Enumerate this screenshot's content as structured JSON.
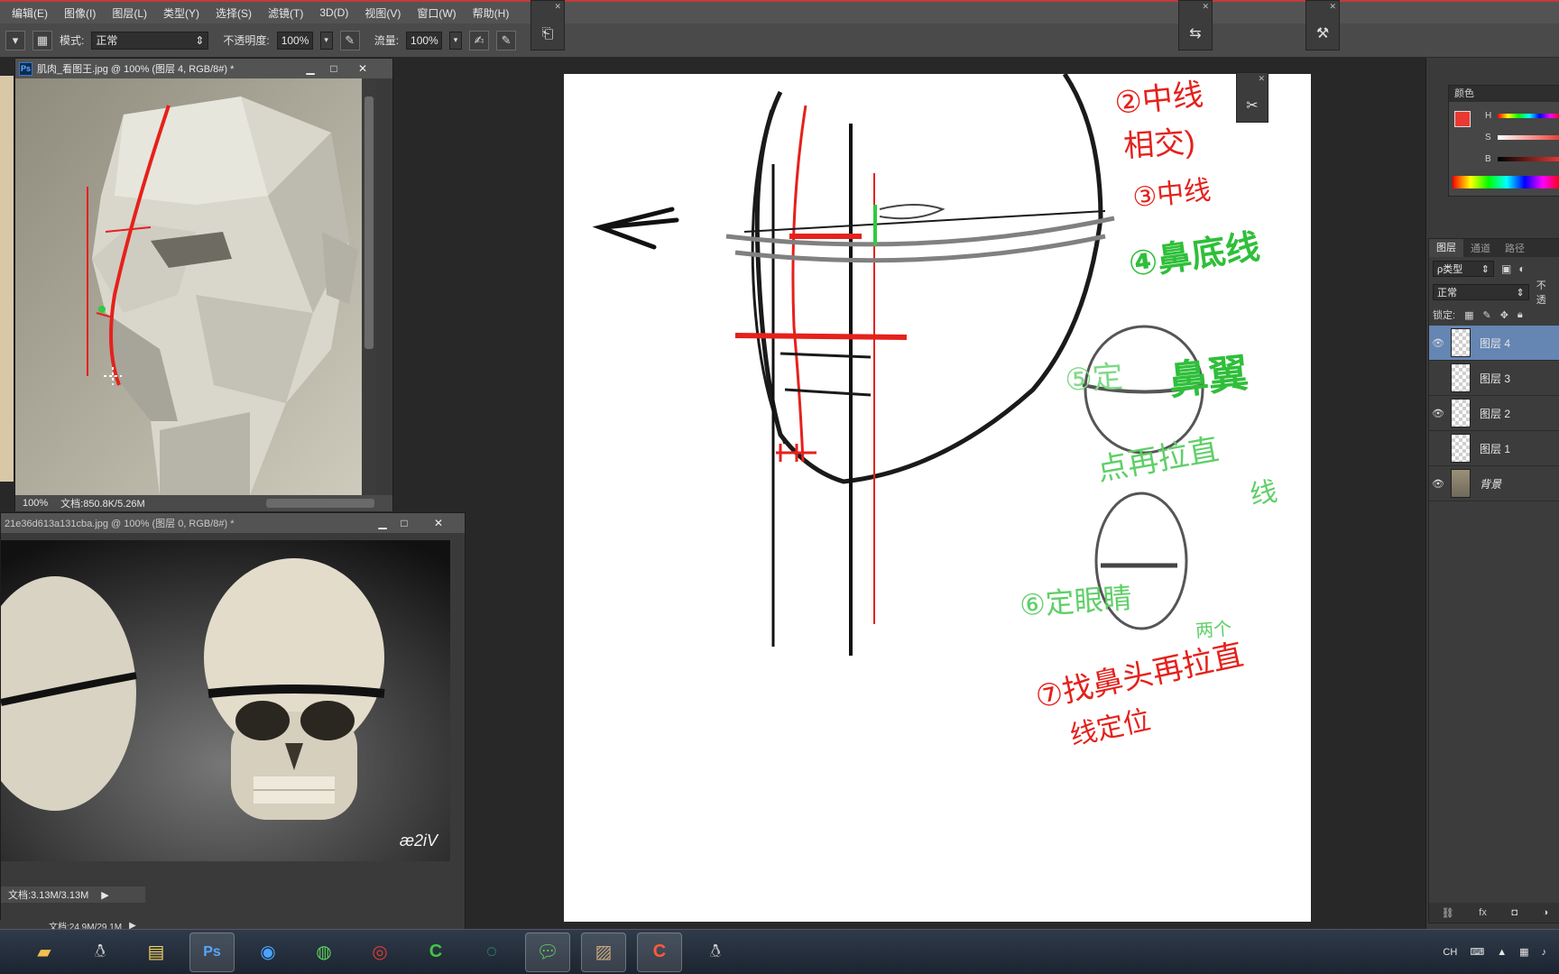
{
  "menu": [
    "编辑(E)",
    "图像(I)",
    "图层(L)",
    "类型(Y)",
    "选择(S)",
    "滤镜(T)",
    "3D(D)",
    "视图(V)",
    "窗口(W)",
    "帮助(H)"
  ],
  "options": {
    "mode_label": "模式:",
    "mode_value": "正常",
    "opacity_label": "不透明度:",
    "opacity_value": "100%",
    "flow_label": "流量:",
    "flow_value": "100%"
  },
  "doc1": {
    "title": "肌肉_看图王.jpg @ 100% (图层 4, RGB/8#) *",
    "zoom": "100%",
    "doc_size": "文档:850.8K/5.26M"
  },
  "doc2": {
    "title": "21e36d613a131cba.jpg @ 100% (图层 0, RGB/8#) *",
    "doc_size": "文档:3.13M/3.13M"
  },
  "main_status": {
    "doc_size": "文档:24.9M/29.1M"
  },
  "canvas_notes": {
    "n2": "②中线",
    "n2b": "相交)",
    "n3": "③中线",
    "n4": "④鼻底线",
    "n5a": "⑤定",
    "n5b": "鼻翼",
    "n5c": "点再拉直",
    "n5d": "线",
    "n6": "⑥定眼睛",
    "n6b": "两个",
    "n7a": "⑦找鼻头再拉直",
    "n7b": "线定位"
  },
  "color_panel": {
    "title": "颜色",
    "h_label": "H",
    "s_label": "S",
    "b_label": "B",
    "fg_color": "#e83a32",
    "bg_color": "#1a1a1a"
  },
  "layers_panel": {
    "tabs": [
      "图层",
      "通道",
      "路径"
    ],
    "filter": "ρ类型",
    "blend": "正常",
    "opacity_label": "不透",
    "lock_label": "锁定:",
    "layers": [
      {
        "name": "图层 4",
        "visible": true,
        "selected": true
      },
      {
        "name": "图层 3",
        "visible": false,
        "selected": false
      },
      {
        "name": "图层 2",
        "visible": true,
        "selected": false
      },
      {
        "name": "图层 1",
        "visible": false,
        "selected": false
      },
      {
        "name": "背景",
        "visible": true,
        "selected": false
      }
    ]
  },
  "taskbar": {
    "apps": [
      "file-explorer",
      "qq",
      "notepad",
      "photoshop",
      "browser",
      "360-browser",
      "netease-music",
      "camtasia",
      "iqiyi",
      "wechat",
      "photo-viewer",
      "camtasia-recorder",
      "qq-pet"
    ],
    "lang": "CH"
  },
  "watermark": "æ2iV"
}
